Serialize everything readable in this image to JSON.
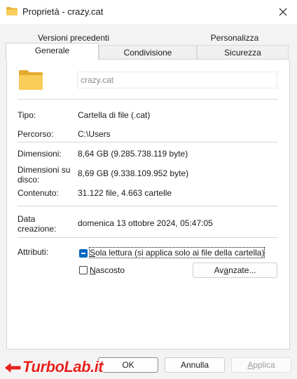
{
  "window": {
    "title": "Proprietà - crazy.cat",
    "close_icon": "close-icon"
  },
  "tabs": {
    "row1": [
      {
        "label": "Versioni precedenti"
      },
      {
        "label": "Personalizza"
      }
    ],
    "row2": [
      {
        "label": "Generale",
        "active": true
      },
      {
        "label": "Condivisione"
      },
      {
        "label": "Sicurezza"
      }
    ]
  },
  "general": {
    "folder_icon": "folder-icon",
    "name_value": "crazy.cat",
    "type": {
      "label": "Tipo:",
      "value": "Cartella di file (.cat)"
    },
    "location": {
      "label": "Percorso:",
      "value": "C:\\Users"
    },
    "size": {
      "label": "Dimensioni:",
      "value": "8,64 GB (9.285.738.119 byte)"
    },
    "size_on_disk": {
      "label": "Dimensioni su disco:",
      "value": "8,69 GB (9.338.109.952 byte)"
    },
    "contains": {
      "label": "Contenuto:",
      "value": "31.122 file, 4.663 cartelle"
    },
    "created": {
      "label": "Data creazione:",
      "value": "domenica 13 ottobre 2024, 05:47:05"
    },
    "attributes": {
      "label": "Attributi:",
      "readonly_label": "Sola lettura (si applica solo ai file della cartella)",
      "readonly_state": "indeterminate",
      "hidden_label": "Nascosto",
      "hidden_state": "unchecked",
      "advanced_label": "Avanzate..."
    }
  },
  "buttons": {
    "ok": "OK",
    "cancel": "Annulla",
    "apply": "Applica"
  },
  "watermark": {
    "text": "TurboLab.it",
    "color": "#e5221e"
  },
  "colors": {
    "accent": "#0067c0",
    "folder": "#f5c342"
  }
}
